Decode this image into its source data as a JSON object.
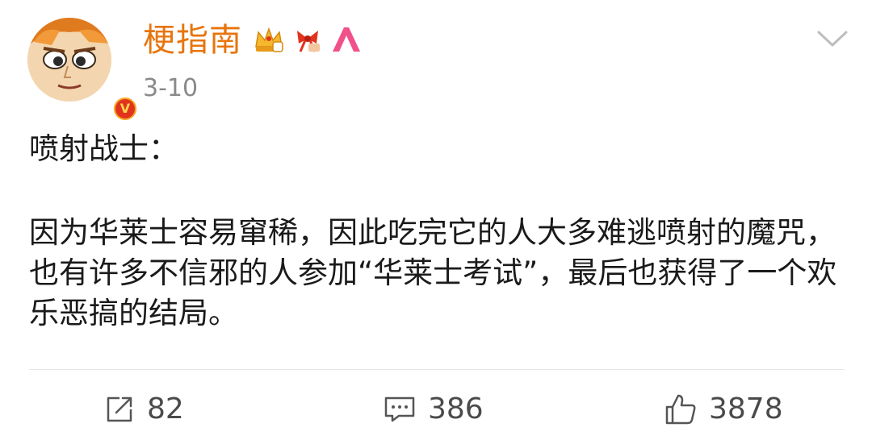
{
  "post": {
    "username": "梗指南",
    "timestamp": "3-10",
    "verified_badge": "V",
    "content": {
      "title": "喷射战士：",
      "body": "因为华莱士容易窜稀，因此吃完它的人大多难逃喷射的魔咒，也有许多不信邪的人参加“华莱士考试”，最后也获得了一个欢乐恶搞的结局。"
    }
  },
  "actions": {
    "repost_count": "82",
    "comment_count": "386",
    "like_count": "3878"
  },
  "icons": {
    "badges": [
      "crown-badge-icon",
      "bow-badge-icon",
      "pink-a-badge-icon"
    ],
    "chevron": "chevron-down-icon",
    "repost": "share-icon",
    "comment": "comment-icon",
    "like": "thumbs-up-icon"
  },
  "colors": {
    "username": "#e8740c",
    "timestamp": "#8a8a8a",
    "verified": "#e2331d"
  }
}
